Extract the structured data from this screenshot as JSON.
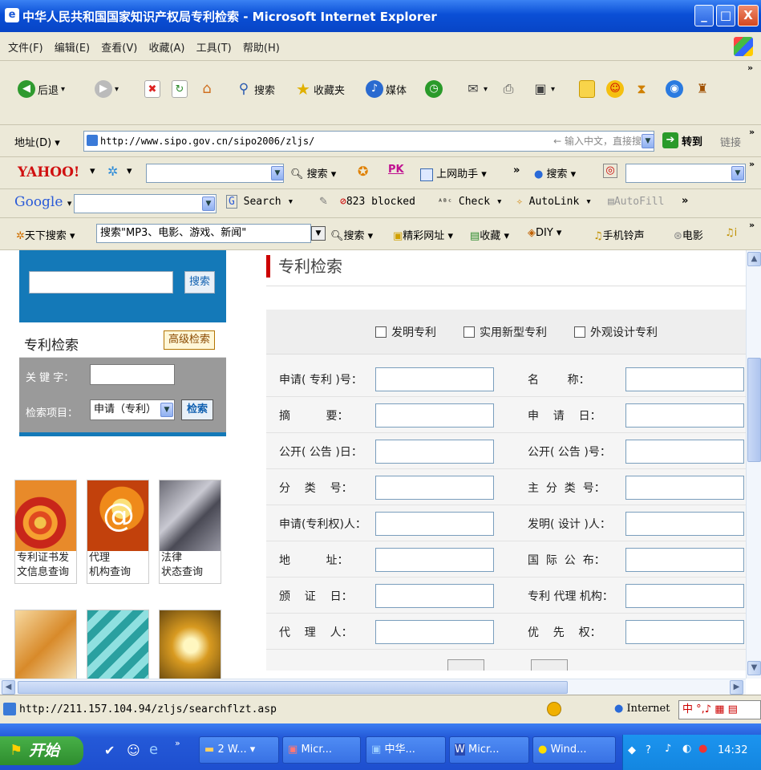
{
  "window": {
    "title": "中华人民共和国国家知识产权局专利检索 - Microsoft Internet Explorer",
    "min": "_",
    "max": "□",
    "close": "X"
  },
  "menu": [
    "文件(F)",
    "编辑(E)",
    "查看(V)",
    "收藏(A)",
    "工具(T)",
    "帮助(H)"
  ],
  "toolbar": {
    "back": "后退",
    "search": "搜索",
    "favorites": "收藏夹",
    "media": "媒体"
  },
  "address": {
    "label": "地址(D)",
    "url": "http://www.sipo.gov.cn/sipo2006/zljs/",
    "hint": "← 输入中文，直接搜索",
    "go": "转到",
    "links": "链接"
  },
  "yahoo": {
    "logo": "YAHOO!",
    "search": "搜索",
    "pk": "PK",
    "assistant": "上网助手",
    "search2": "搜索"
  },
  "google": {
    "logo": "Google",
    "search": "Search",
    "blocked": "823 blocked",
    "check": "Check",
    "autolink": "AutoLink",
    "autofill": "AutoFill"
  },
  "sogou": {
    "label": "天下搜索",
    "query": "搜索\"MP3、电影、游戏、新闻\"",
    "search": "搜索",
    "sites": "精彩网址",
    "fav": "收藏",
    "diy": "DIY",
    "ring": "手机铃声",
    "movie": "电影"
  },
  "left": {
    "search_btn": "搜索",
    "patent_search": "专利检索",
    "advanced": "高级检索",
    "keyword_label": "关 键 字：",
    "item_label": "检索项目：",
    "item_value": "申请（专利）",
    "go": "检索",
    "tiles": [
      {
        "label": "专利证书发\n文信息查询"
      },
      {
        "label": "代理\n机构查询"
      },
      {
        "label": "法律\n状态查询"
      }
    ]
  },
  "main": {
    "title": "专利检索",
    "types": [
      "发明专利",
      "实用新型专利",
      "外观设计专利"
    ],
    "rows": [
      [
        "申请( 专利 )号：",
        "名        称："
      ],
      [
        "摘          要：",
        "申    请    日："
      ],
      [
        "公开( 公告 )日：",
        "公开( 公告 )号："
      ],
      [
        "分    类    号：",
        "主  分  类  号："
      ],
      [
        "申请(专利权)人：",
        "发明( 设计 )人："
      ],
      [
        "地          址：",
        "国  际  公  布："
      ],
      [
        "颁    证    日：",
        "专利 代理 机构："
      ],
      [
        "代    理    人：",
        "优    先    权："
      ]
    ]
  },
  "status": {
    "url": "http://211.157.104.94/zljs/searchflzt.asp",
    "zone": "Internet"
  },
  "taskbar": {
    "start": "开始",
    "tasks": [
      "2 W...",
      "Micr...",
      "中华...",
      "Micr...",
      "Wind..."
    ],
    "clock": "14:32"
  }
}
